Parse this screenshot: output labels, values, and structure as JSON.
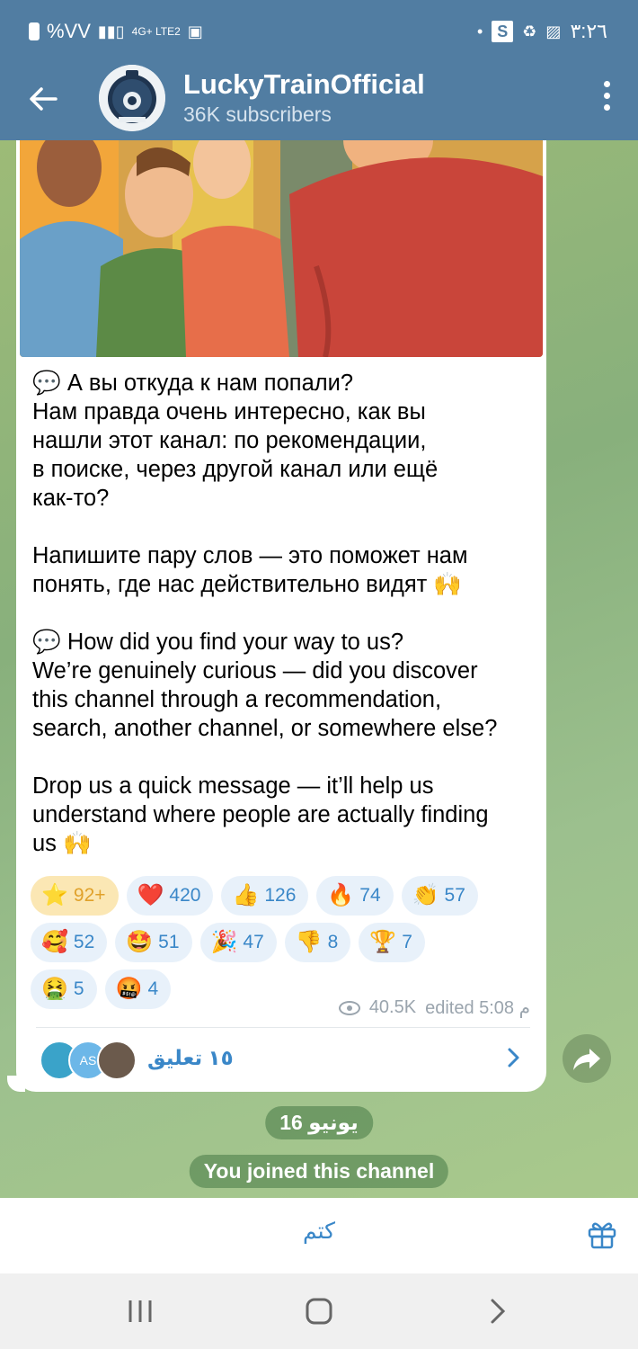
{
  "status_bar": {
    "left_text": "%VV",
    "network": "4G+ LTE2",
    "right_text": "٣:٢٦"
  },
  "header": {
    "channel_name": "LuckyTrainOfficial",
    "subscribers": "36K subscribers"
  },
  "post": {
    "text_ru_q": "💬 А вы откуда к нам попали?",
    "text_ru_1": "Нам правда очень интересно, как вы\nнашли этот канал: по рекомендации,\nв поиске, через другой канал или ещё\nкак-то?",
    "text_ru_2": "Напишите пару слов — это поможет нам\nпонять, где нас действительно видят 🙌",
    "text_en_q": "💬 How did you find your way to us?",
    "text_en_1": "We’re genuinely curious — did you discover\nthis channel through a recommendation,\nsearch, another channel, or somewhere else?",
    "text_en_2": "Drop us a quick message — it’ll help us\nunderstand where people are actually finding\nus 🙌",
    "reactions": [
      [
        {
          "emoji": "⭐",
          "count": "92+",
          "active": true
        },
        {
          "emoji": "❤️",
          "count": "420"
        },
        {
          "emoji": "👍",
          "count": "126"
        },
        {
          "emoji": "🔥",
          "count": "74"
        },
        {
          "emoji": "👏",
          "count": "57"
        }
      ],
      [
        {
          "emoji": "🥰",
          "count": "52"
        },
        {
          "emoji": "🤩",
          "count": "51"
        },
        {
          "emoji": "🎉",
          "count": "47"
        },
        {
          "emoji": "👎",
          "count": "8"
        },
        {
          "emoji": "🏆",
          "count": "7"
        }
      ],
      [
        {
          "emoji": "🤮",
          "count": "5"
        },
        {
          "emoji": "🤬",
          "count": "4"
        }
      ]
    ],
    "views": "40.5K",
    "edited_time": "edited 5:08 م",
    "comments_label": "١٥ تعليق"
  },
  "date_pill": "16 يونيو",
  "service_message": "You joined this channel",
  "bottom_bar": {
    "mute_label": "كتم"
  },
  "colors": {
    "header_bg": "#517da2",
    "accent": "#3a87c8",
    "wallpaper": "#8fb079"
  }
}
